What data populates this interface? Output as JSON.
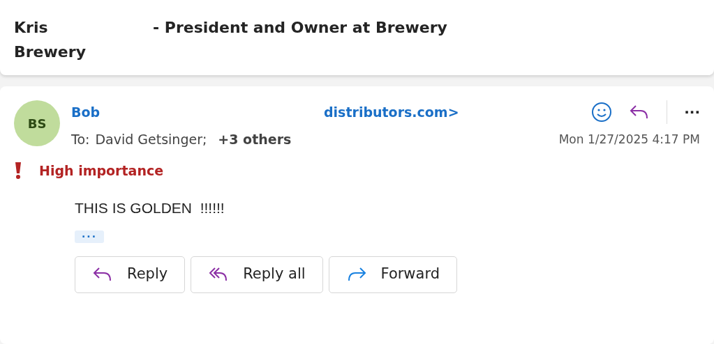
{
  "header": {
    "name_first": "Kris",
    "title": "- President and Owner at Brewery",
    "name_second": "Brewery"
  },
  "message": {
    "avatar": {
      "initials": "BS",
      "color": "#c0dc9c"
    },
    "sender_start": "Bob",
    "sender_end": "distributors.com>",
    "to_label": "To:",
    "recipients": "David Getsinger;",
    "others": "+3 others",
    "date": "Mon 1/27/2025 4:17 PM",
    "more": "···",
    "importance": {
      "high": true,
      "label": "High importance"
    },
    "body": "THIS IS GOLDEN  !!!!!!",
    "expand": "···",
    "actions": [
      {
        "kind": "reply",
        "label": "Reply"
      },
      {
        "kind": "reply_all",
        "label": "Reply all"
      },
      {
        "kind": "forward",
        "label": "Forward"
      }
    ]
  }
}
